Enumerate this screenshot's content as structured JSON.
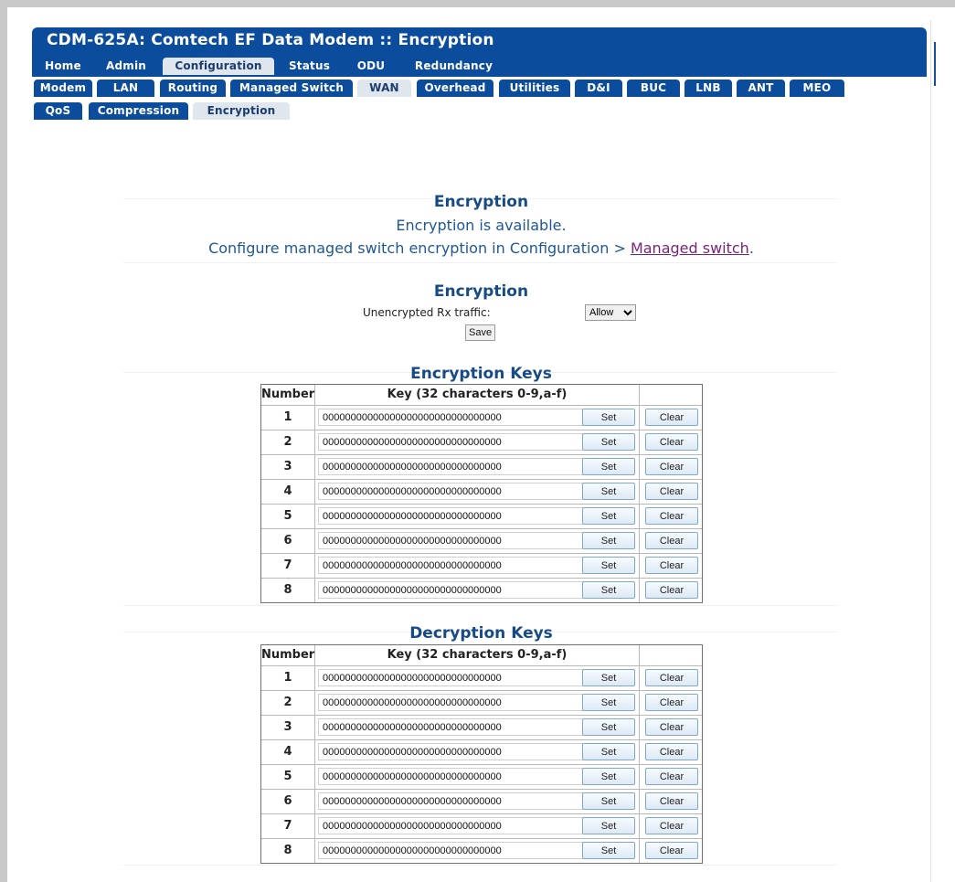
{
  "header": {
    "title": "CDM-625A: Comtech EF Data Modem :: Encryption"
  },
  "nav": {
    "row1": [
      "Home",
      "Admin",
      "Configuration",
      "Status",
      "ODU",
      "Redundancy"
    ],
    "row2": [
      "Modem",
      "LAN",
      "Routing",
      "Managed Switch",
      "WAN",
      "Overhead",
      "Utilities",
      "D&I",
      "BUC",
      "LNB",
      "ANT",
      "MEO"
    ],
    "row3": [
      "QoS",
      "Compression",
      "Encryption"
    ],
    "active": [
      "Configuration",
      "WAN",
      "Encryption"
    ]
  },
  "info": {
    "title": "Encryption",
    "available": "Encryption is available.",
    "configure_text": "Configure managed switch encryption in Configuration > ",
    "configure_link": "Managed switch",
    "configure_end": "."
  },
  "settings": {
    "title": "Encryption",
    "rx_label": "Unencrypted Rx traffic:",
    "rx_value": "Allow",
    "save_label": "Save"
  },
  "encryption_keys": {
    "title": "Encryption Keys",
    "col_number": "Number",
    "col_key": "Key (32 characters 0-9,a-f)",
    "rows": [
      {
        "n": "1",
        "key": "00000000000000000000000000000000"
      },
      {
        "n": "2",
        "key": "00000000000000000000000000000000"
      },
      {
        "n": "3",
        "key": "00000000000000000000000000000000"
      },
      {
        "n": "4",
        "key": "00000000000000000000000000000000"
      },
      {
        "n": "5",
        "key": "00000000000000000000000000000000"
      },
      {
        "n": "6",
        "key": "00000000000000000000000000000000"
      },
      {
        "n": "7",
        "key": "00000000000000000000000000000000"
      },
      {
        "n": "8",
        "key": "00000000000000000000000000000000"
      }
    ]
  },
  "decryption_keys": {
    "title": "Decryption Keys",
    "col_number": "Number",
    "col_key": "Key (32 characters 0-9,a-f)",
    "rows": [
      {
        "n": "1",
        "key": "00000000000000000000000000000000"
      },
      {
        "n": "2",
        "key": "00000000000000000000000000000000"
      },
      {
        "n": "3",
        "key": "00000000000000000000000000000000"
      },
      {
        "n": "4",
        "key": "00000000000000000000000000000000"
      },
      {
        "n": "5",
        "key": "00000000000000000000000000000000"
      },
      {
        "n": "6",
        "key": "00000000000000000000000000000000"
      },
      {
        "n": "7",
        "key": "00000000000000000000000000000000"
      },
      {
        "n": "8",
        "key": "00000000000000000000000000000000"
      }
    ]
  },
  "buttons": {
    "set": "Set",
    "clear": "Clear"
  }
}
